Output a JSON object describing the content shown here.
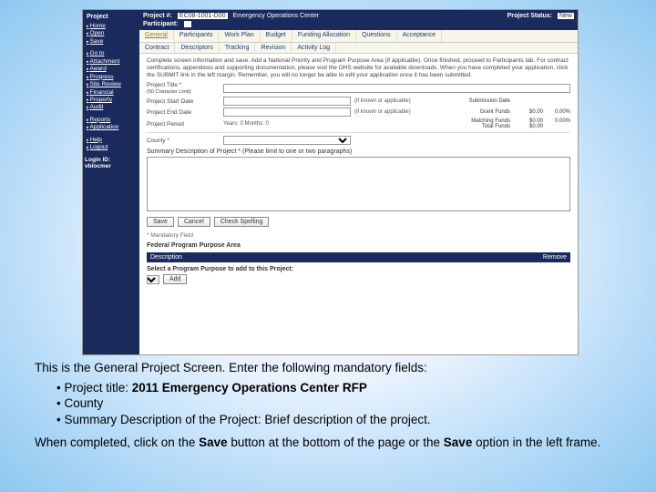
{
  "sidebar": {
    "header": "Project",
    "group1": [
      "Home",
      "Open",
      "Save"
    ],
    "group2": [
      "Go to",
      "Attachment",
      "Award",
      "Progress",
      "Site Review",
      "Financial",
      "Property",
      "Audit"
    ],
    "group3": [
      "Reports",
      "Application"
    ],
    "group4": [
      "Help",
      "Logout"
    ],
    "login_label": "Login ID:",
    "login_val": "vblocmer"
  },
  "topbar": {
    "proj_label": "Project #:",
    "proj_val": "EC08-1001-D00",
    "proj_name": "Emergency Operations Center",
    "status_label": "Project Status:",
    "status_val": "New",
    "participant_label": "Participant:"
  },
  "tabs1": [
    "General",
    "Participants",
    "Work Plan",
    "Budget",
    "Funding Allocation",
    "Questions",
    "Acceptance"
  ],
  "tabs2": [
    "Contract",
    "Descriptors",
    "Tracking",
    "Revision",
    "Activity Log"
  ],
  "content": {
    "intro": "Complete screen information and save. Add a National Priority and Program Purpose Area (if applicable). Once finished, proceed to Participants tab. For contract certifications, appendices and supporting documentation, please visit the OHS website for available downloads. When you have completed your application, click the SUBMIT link in the left margin. Remember, you will no longer be able to edit your application once it has been submitted.",
    "title_label": "Project Title *",
    "title_hint": "(50 Character Limit)",
    "start_label": "Project Start Date",
    "end_label": "Project End Date",
    "period_label": "Project Period",
    "period_val": "Years: 0  Months: 0",
    "known": "(if known or applicable)",
    "sub_date": "Submission Date",
    "grant": "Grant Funds",
    "match": "Matching Funds",
    "total": "Total Funds",
    "amount0": "$0.00",
    "pct0": "0.00%",
    "county_label": "County *",
    "summary_label": "Summary Description of Project * (Please limit to one or two paragraphs)",
    "save": "Save",
    "cancel": "Cancel",
    "check": "Check Spelling",
    "mand": "*  Mandatory Field",
    "fed_hdr": "Federal Program Purpose Area",
    "col_desc": "Description",
    "col_rem": "Remove",
    "select_purpose": "Select a Program Purpose to add to this Project:",
    "add_btn": "Add"
  },
  "caption": {
    "intro": "This is the General Project Screen.  Enter the following mandatory fields:",
    "b1a": "Project title: ",
    "b1b": "2011 Emergency Operations Center RFP",
    "b2": "County",
    "b3": "Summary Description of the Project:  Brief description of the project.",
    "closing1": "When completed, click on the ",
    "closing_save": "Save",
    "closing2": " button at the bottom of the page or the ",
    "closing3": " option in the left frame."
  }
}
